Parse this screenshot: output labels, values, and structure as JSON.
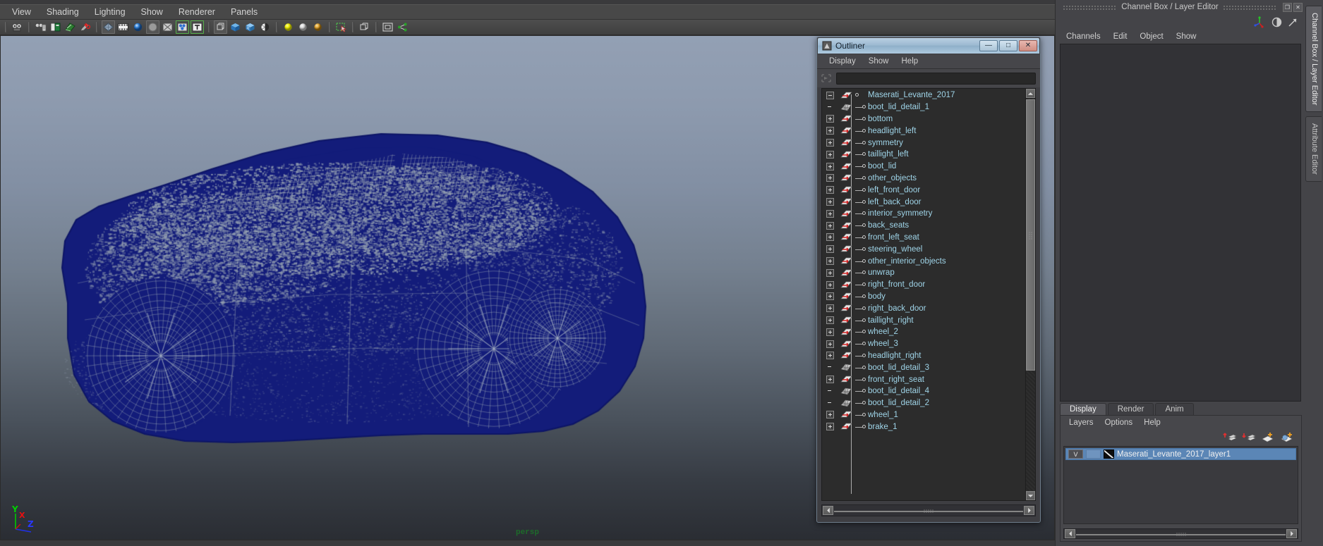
{
  "viewport_panel": {
    "menus": [
      "View",
      "Shading",
      "Lighting",
      "Show",
      "Renderer",
      "Panels"
    ],
    "toolbar_icons": [
      {
        "name": "camera-attributes-icon",
        "label": "Camera Attributes"
      },
      {
        "name": "camera-list-icon",
        "label": "Camera Bookmarks"
      },
      {
        "name": "image-plane-icon",
        "label": "Image Plane"
      },
      {
        "name": "two-d-pan-zoom-icon",
        "label": "2D Pan/Zoom"
      },
      {
        "name": "grease-pencil-icon",
        "label": "Grease Pencil"
      },
      {
        "name": "wireframe-on-shaded-icon",
        "label": "Wireframe on Shaded"
      },
      {
        "name": "film-gate-icon",
        "label": "Film Gate"
      },
      {
        "name": "shaded-sphere-icon",
        "label": "Smooth Shade All"
      },
      {
        "name": "flat-shade-icon",
        "label": "Flat Shade"
      },
      {
        "name": "xray-icon",
        "label": "X-Ray"
      },
      {
        "name": "texture-icon",
        "label": "Hardware Texturing"
      },
      {
        "name": "text-overlay-icon",
        "label": "Display Text"
      },
      {
        "name": "wireframe-box-icon",
        "label": "Wireframe"
      },
      {
        "name": "shaded-box-icon",
        "label": "Smooth Shaded"
      },
      {
        "name": "shaded-textured-box-icon",
        "label": "Shaded and Textured"
      },
      {
        "name": "checker-sphere-icon",
        "label": "Texture Display"
      },
      {
        "name": "light-yellow-icon",
        "label": "Use Default Lighting"
      },
      {
        "name": "light-white-icon",
        "label": "Use All Lights"
      },
      {
        "name": "light-amber-icon",
        "label": "Use Scene Lights"
      },
      {
        "name": "select-marquee-icon",
        "label": "Isolate Select"
      },
      {
        "name": "bounding-box-icon",
        "label": "Bounding Box"
      },
      {
        "name": "panel-layout-icon",
        "label": "Panel Layout"
      },
      {
        "name": "share-graph-icon",
        "label": "Shared Display"
      }
    ],
    "camera_label": "persp",
    "axis_gizmo": {
      "y": "Y",
      "x": "X",
      "z": "Z"
    },
    "background_top_color": "#93a0b4",
    "background_bottom_color": "#2a2d33",
    "wireframe_color": "#131c7a"
  },
  "outliner": {
    "title": "Outliner",
    "window_buttons": {
      "minimize": "—",
      "maximize": "□",
      "close": "✕"
    },
    "menus": [
      "Display",
      "Show",
      "Help"
    ],
    "search_value": "",
    "search_placeholder": "",
    "tree": [
      {
        "label": "Maserati_Levante_2017",
        "expander": "minus",
        "icon": "transform-icon",
        "root": true
      },
      {
        "label": "boot_lid_detail_1",
        "expander": "none",
        "icon": "mesh-icon"
      },
      {
        "label": "bottom",
        "expander": "plus",
        "icon": "transform-icon"
      },
      {
        "label": "headlight_left",
        "expander": "plus",
        "icon": "transform-icon"
      },
      {
        "label": "symmetry",
        "expander": "plus",
        "icon": "transform-icon"
      },
      {
        "label": "taillight_left",
        "expander": "plus",
        "icon": "transform-icon"
      },
      {
        "label": "boot_lid",
        "expander": "plus",
        "icon": "transform-icon"
      },
      {
        "label": "other_objects",
        "expander": "plus",
        "icon": "transform-icon"
      },
      {
        "label": "left_front_door",
        "expander": "plus",
        "icon": "transform-icon"
      },
      {
        "label": "left_back_door",
        "expander": "plus",
        "icon": "transform-icon"
      },
      {
        "label": "interior_symmetry",
        "expander": "plus",
        "icon": "transform-icon"
      },
      {
        "label": "back_seats",
        "expander": "plus",
        "icon": "transform-icon"
      },
      {
        "label": "front_left_seat",
        "expander": "plus",
        "icon": "transform-icon"
      },
      {
        "label": "steering_wheel",
        "expander": "plus",
        "icon": "transform-icon"
      },
      {
        "label": "other_interior_objects",
        "expander": "plus",
        "icon": "transform-icon"
      },
      {
        "label": "unwrap",
        "expander": "plus",
        "icon": "transform-icon"
      },
      {
        "label": "right_front_door",
        "expander": "plus",
        "icon": "transform-icon"
      },
      {
        "label": "body",
        "expander": "plus",
        "icon": "transform-icon"
      },
      {
        "label": "right_back_door",
        "expander": "plus",
        "icon": "transform-icon"
      },
      {
        "label": "taillight_right",
        "expander": "plus",
        "icon": "transform-icon"
      },
      {
        "label": "wheel_2",
        "expander": "plus",
        "icon": "transform-icon"
      },
      {
        "label": "wheel_3",
        "expander": "plus",
        "icon": "transform-icon"
      },
      {
        "label": "headlight_right",
        "expander": "plus",
        "icon": "transform-icon"
      },
      {
        "label": "boot_lid_detail_3",
        "expander": "none",
        "icon": "mesh-icon"
      },
      {
        "label": "front_right_seat",
        "expander": "plus",
        "icon": "transform-icon"
      },
      {
        "label": "boot_lid_detail_4",
        "expander": "none",
        "icon": "mesh-icon"
      },
      {
        "label": "boot_lid_detail_2",
        "expander": "none",
        "icon": "mesh-icon"
      },
      {
        "label": "wheel_1",
        "expander": "plus",
        "icon": "transform-icon"
      },
      {
        "label": "brake_1",
        "expander": "plus",
        "icon": "transform-icon"
      }
    ]
  },
  "right_panel": {
    "title": "Channel Box / Layer Editor",
    "window_buttons": {
      "restore": "❐",
      "close": "✕"
    },
    "tool_icons": [
      {
        "name": "axis-manipulator-icon"
      },
      {
        "name": "half-circle-icon"
      },
      {
        "name": "arrow-up-right-icon"
      }
    ],
    "channel_menus": [
      "Channels",
      "Edit",
      "Object",
      "Show"
    ],
    "channel_content": "",
    "layer_tabs": [
      {
        "label": "Display",
        "active": true
      },
      {
        "label": "Render",
        "active": false
      },
      {
        "label": "Anim",
        "active": false
      }
    ],
    "layer_menus": [
      "Layers",
      "Options",
      "Help"
    ],
    "layer_buttons": [
      {
        "name": "move-layer-up-icon"
      },
      {
        "name": "move-layer-down-icon"
      },
      {
        "name": "new-empty-layer-icon"
      },
      {
        "name": "new-layer-from-selected-icon"
      }
    ],
    "layers": [
      {
        "visibility": "V",
        "mode": "",
        "name": "Maserati_Levante_2017_layer1",
        "selected": true
      }
    ],
    "vertical_tabs": [
      {
        "label": "Channel Box / Layer Editor",
        "active": true
      },
      {
        "label": "Attribute Editor",
        "active": false
      }
    ]
  }
}
